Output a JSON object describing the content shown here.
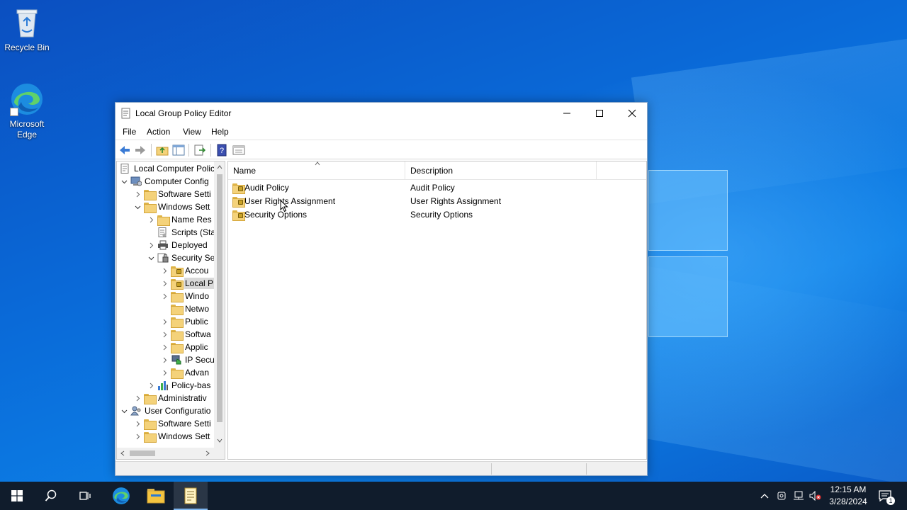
{
  "desktop": {
    "icons": [
      {
        "label": "Recycle Bin"
      },
      {
        "label_line1": "Microsoft",
        "label_line2": "Edge"
      }
    ]
  },
  "window": {
    "title": "Local Group Policy Editor",
    "menu": [
      "File",
      "Action",
      "View",
      "Help"
    ],
    "tree": [
      {
        "label": "Local Computer Polic"
      },
      {
        "label": "Computer Config"
      },
      {
        "label": "Software Setti"
      },
      {
        "label": "Windows Sett"
      },
      {
        "label": "Name Res"
      },
      {
        "label": "Scripts (Sta"
      },
      {
        "label": "Deployed"
      },
      {
        "label": "Security Se"
      },
      {
        "label": "Accou"
      },
      {
        "label": "Local P"
      },
      {
        "label": "Windo"
      },
      {
        "label": "Netwo"
      },
      {
        "label": "Public"
      },
      {
        "label": "Softwa"
      },
      {
        "label": "Applic"
      },
      {
        "label": "IP Secu"
      },
      {
        "label": "Advan"
      },
      {
        "label": "Policy-bas"
      },
      {
        "label": "Administrativ"
      },
      {
        "label": "User Configuratio"
      },
      {
        "label": "Software Setti"
      },
      {
        "label": "Windows Sett"
      }
    ],
    "list": {
      "columns": [
        "Name",
        "Description"
      ],
      "rows": [
        {
          "name": "Audit Policy",
          "description": "Audit Policy"
        },
        {
          "name": "User Rights Assignment",
          "description": "User Rights Assignment"
        },
        {
          "name": "Security Options",
          "description": "Security Options"
        }
      ]
    }
  },
  "taskbar": {
    "time": "12:15 AM",
    "date": "3/28/2024",
    "notification_count": "1"
  },
  "colors": {
    "desktop_blue": "#0a6ad8",
    "taskbar": "#101c2c",
    "selection": "#d9d9d9"
  }
}
